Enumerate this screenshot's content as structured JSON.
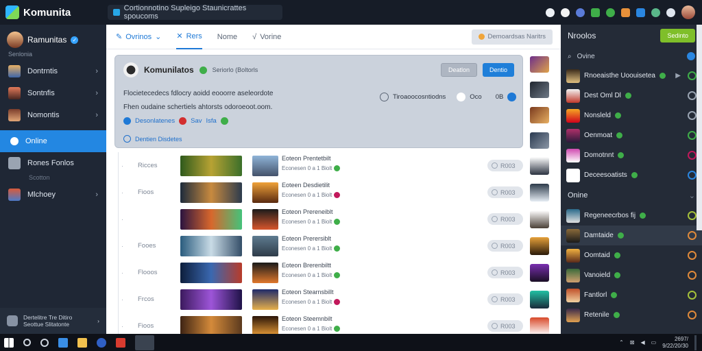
{
  "app": {
    "name": "Komunita"
  },
  "search": {
    "placeholder": "Cortionnotino Supleigo Staunicrattes spoucoms"
  },
  "colors": {
    "accent": "#2387e2",
    "verified": "#3fae49",
    "primary_button": "#7fbf2a",
    "background": "#1b2230"
  },
  "left": {
    "profile_name": "Ramunitas",
    "profile_sub": "Senlonia",
    "items": [
      {
        "label": "Dontrntis",
        "sub": ""
      },
      {
        "label": "Sontnfis",
        "sub": ""
      },
      {
        "label": "Nomontis",
        "sub": ""
      },
      {
        "label": "Online",
        "sub": "",
        "active": true
      },
      {
        "label": "Rones Fonlos",
        "sub": "Scotton"
      },
      {
        "label": "Mlchoey",
        "sub": ""
      }
    ],
    "footer_line1": "Dertelitre Tre Ditiro",
    "footer_line2": "Seottue Slitatonte"
  },
  "tabs": [
    {
      "label": "Ovrinos",
      "icon": "megaphone-icon"
    },
    {
      "label": "Rers",
      "icon": "tools-icon"
    },
    {
      "label": "Nome",
      "icon": ""
    },
    {
      "label": "Vorine",
      "icon": "signal-icon"
    }
  ],
  "tab_button": "Demoardsas Naritrs",
  "card": {
    "name": "Komunilatos",
    "meta": "Seriorlo (Boltorls",
    "btn_secondary": "Deatlon",
    "btn_primary": "Dentio",
    "line1": "Flocietecedecs fdlocry aoidd eooorre aseleordote",
    "line2": "Fhen oudaine schertiels ahtorsts odoroeoot.oom.",
    "stat_label": "Tiroaoocosntiodns",
    "stat_a": "Oco",
    "stat_b": "0B",
    "link1": "Desonlatenes",
    "link2": "Sav",
    "link3": "Isfa",
    "footer": "Dentien Disdetes"
  },
  "rows": [
    {
      "label": "Ricces",
      "title": "Eoteon Prentetbilt",
      "sub": "Econesen 0 a 1 Biolt",
      "badge": "green",
      "pill": "R003"
    },
    {
      "label": "Fioos",
      "title": "Eoteen Desdietilit",
      "sub": "Econesen 0 a 1 Biolt",
      "badge": "red",
      "pill": "R003"
    },
    {
      "label": "",
      "title": "Eoteon Prereneiblt",
      "sub": "Econesen 0 a 1 Biolt",
      "badge": "green",
      "pill": "R003"
    },
    {
      "label": "Fooes",
      "title": "Eoteon Prerersiblt",
      "sub": "Econesen 0 a 1 Biolt",
      "badge": "green",
      "pill": "R003"
    },
    {
      "label": "Flooos",
      "title": "Eoteon Brerenbiltt",
      "sub": "Econesen 0 a 1 Biolt",
      "badge": "green",
      "pill": "R003"
    },
    {
      "label": "Frcos",
      "title": "Eoteon Stearnsbillt",
      "sub": "Econesen 0 a 1 Biolt",
      "badge": "red",
      "pill": "R003"
    },
    {
      "label": "Fioos",
      "title": "Eoteon Steemnbilt",
      "sub": "Econesen 0 a 1 Biolt",
      "badge": "green",
      "pill": "R003"
    }
  ],
  "right": {
    "title": "Nroolos",
    "button": "Sedinto",
    "search_label": "Ovine",
    "friends_top": [
      {
        "name": "Rnoeaisthe Uoouisetea",
        "highlight": false,
        "arrow": true,
        "status_color": "#3fae49"
      },
      {
        "name": "Dest Oml Dl",
        "highlight": false,
        "arrow": false,
        "status_color": "#9aa4b2"
      },
      {
        "name": "Nonsleld",
        "highlight": false,
        "arrow": false,
        "status_color": "#9aa4b2"
      },
      {
        "name": "Oenmoat",
        "highlight": false,
        "arrow": false,
        "status_color": "#3fae49"
      },
      {
        "name": "Domotnnt",
        "highlight": false,
        "arrow": false,
        "status_color": "#c2185b"
      },
      {
        "name": "Deceesoatists",
        "highlight": false,
        "arrow": false,
        "status_color": "#2a86e0"
      }
    ],
    "section": "Onine",
    "friends_online": [
      {
        "name": "Regeneecrbos fij",
        "highlight": false,
        "status_color": "#a6c23a"
      },
      {
        "name": "Damtaide",
        "highlight": true,
        "status_color": "#e08a3a"
      },
      {
        "name": "Oomtaid",
        "highlight": false,
        "status_color": "#e08a3a"
      },
      {
        "name": "Vanoield",
        "highlight": false,
        "status_color": "#e08a3a"
      },
      {
        "name": "Fantlorl",
        "highlight": false,
        "status_color": "#a6c23a"
      },
      {
        "name": "Retenile",
        "highlight": false,
        "status_color": "#e08a3a"
      }
    ]
  },
  "taskbar": {
    "time": "2697/",
    "date": "9/22/20/30"
  }
}
